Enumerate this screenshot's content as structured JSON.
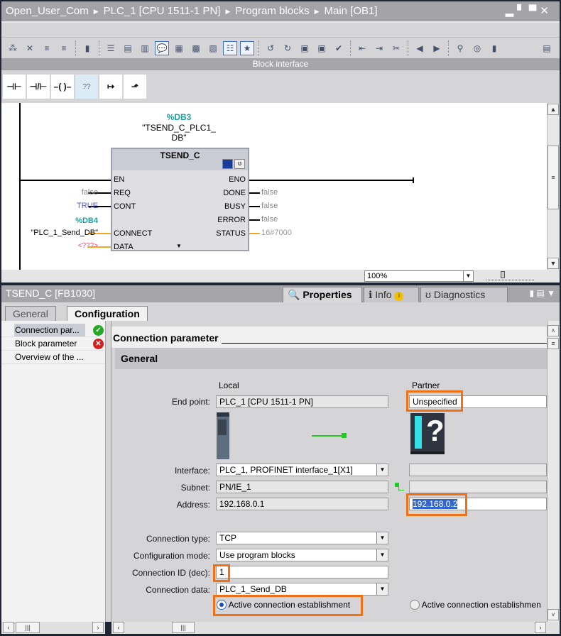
{
  "title": {
    "crumbs": [
      "Open_User_Com",
      "PLC_1 [CPU 1511-1 PN]",
      "Program blocks",
      "Main [OB1]"
    ],
    "window_controls": "▂▘▀✕"
  },
  "toolbar": {
    "block_interface": "Block interface"
  },
  "lad": {
    "contact_no": "⊣⊢",
    "contact_nc": "⊣/⊢",
    "coil": "–( )–",
    "empty_box": "??",
    "branch_open": "↦",
    "branch_close": "⬏"
  },
  "block": {
    "instance_addr": "%DB3",
    "instance_name": "\"TSEND_C_PLC1_",
    "instance_name2": "DB\"",
    "name": "TSEND_C",
    "inputs": [
      {
        "pin": "EN",
        "value": ""
      },
      {
        "pin": "REQ",
        "value": "false"
      },
      {
        "pin": "CONT",
        "value": "TRUE"
      },
      {
        "pin": "CONNECT",
        "addr": "%DB4",
        "value": "\"PLC_1_Send_DB\""
      },
      {
        "pin": "DATA",
        "value": "<???>"
      }
    ],
    "outputs": [
      {
        "pin": "ENO",
        "value": ""
      },
      {
        "pin": "DONE",
        "value": "false"
      },
      {
        "pin": "BUSY",
        "value": "false"
      },
      {
        "pin": "ERROR",
        "value": "false"
      },
      {
        "pin": "STATUS",
        "value": "16#7000"
      }
    ]
  },
  "zoom": "100%",
  "inspector": {
    "title": "TSEND_C [FB1030]",
    "tabs": [
      "Properties",
      "Info",
      "Diagnostics"
    ],
    "subtabs": [
      "General",
      "Configuration"
    ],
    "nav": [
      {
        "label": "Connection par...",
        "status": "ok"
      },
      {
        "label": "Block parameter",
        "status": "error"
      },
      {
        "label": "Overview of the ..."
      }
    ],
    "section": "Connection parameter",
    "group": "General",
    "col_local": "Local",
    "col_partner": "Partner",
    "labels": {
      "end_point": "End point:",
      "interface": "Interface:",
      "subnet": "Subnet:",
      "address": "Address:",
      "conn_type": "Connection type:",
      "config_mode": "Configuration mode:",
      "conn_id": "Connection ID (dec):",
      "conn_data": "Connection data:"
    },
    "local": {
      "end_point": "PLC_1 [CPU 1511-1 PN]",
      "interface": "PLC_1, PROFINET interface_1[X1]",
      "subnet": "PN/IE_1",
      "address": "192.168.0.1"
    },
    "partner": {
      "end_point": "Unspecified",
      "address": "192.168.0.2"
    },
    "conn_type": "TCP",
    "config_mode": "Use program blocks",
    "conn_id": "1",
    "conn_data": "PLC_1_Send_DB",
    "radio_local": "Active connection establishment",
    "radio_partner": "Active connection establishmen"
  },
  "colors": {
    "accent": "#f07018",
    "ok": "#22aa22",
    "error": "#d42020",
    "db": "#1aa3a3"
  }
}
